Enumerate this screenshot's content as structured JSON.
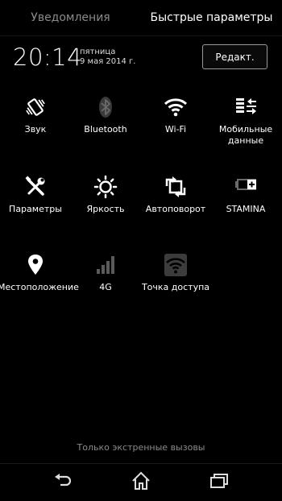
{
  "tabs": {
    "notifications": "Уведомления",
    "quick_settings": "Быстрые параметры"
  },
  "clock": {
    "time": "20:14",
    "weekday": "пятница",
    "date": "9 мая 2014 г."
  },
  "edit_button": "Редакт.",
  "tiles": [
    {
      "label": "Звук",
      "icon": "vibrate-icon"
    },
    {
      "label": "Bluetooth",
      "icon": "bluetooth-icon"
    },
    {
      "label": "Wi-Fi",
      "icon": "wifi-icon"
    },
    {
      "label": "Мобильные данные",
      "icon": "mobile-data-icon"
    },
    {
      "label": "Параметры",
      "icon": "settings-tools-icon"
    },
    {
      "label": "Яркость",
      "icon": "brightness-icon"
    },
    {
      "label": "Автоповорот",
      "icon": "auto-rotate-icon"
    },
    {
      "label": "STAMINA",
      "icon": "stamina-battery-icon"
    },
    {
      "label": "Местоположение",
      "icon": "location-icon"
    },
    {
      "label": "4G",
      "icon": "signal-4g-icon"
    },
    {
      "label": "Точка доступа",
      "icon": "hotspot-icon"
    }
  ],
  "emergency_text": "Только экстренные вызовы",
  "colors": {
    "background": "#000000",
    "inactive_text": "#8a8a8a",
    "disabled_icon": "#5a5a5a"
  }
}
